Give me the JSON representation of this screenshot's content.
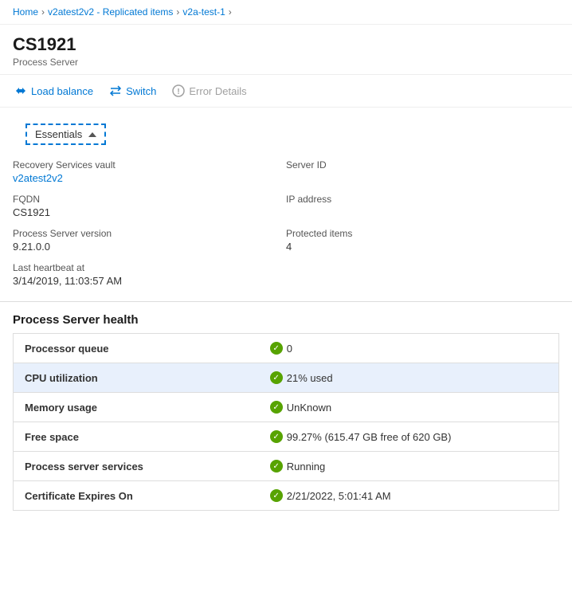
{
  "breadcrumb": {
    "items": [
      {
        "label": "Home",
        "link": true
      },
      {
        "label": "v2atest2v2 - Replicated items",
        "link": true
      },
      {
        "label": "v2a-test-1",
        "link": true
      }
    ]
  },
  "title": {
    "main": "CS1921",
    "subtitle": "Process Server"
  },
  "toolbar": {
    "load_balance": "Load balance",
    "switch": "Switch",
    "error_details": "Error Details"
  },
  "essentials": {
    "tab_label": "Essentials",
    "fields": [
      {
        "label": "Recovery Services vault",
        "value": "v2atest2v2",
        "link": true,
        "col": "left"
      },
      {
        "label": "Server ID",
        "value": "",
        "link": false,
        "col": "right"
      },
      {
        "label": "FQDN",
        "value": "CS1921",
        "link": false,
        "col": "left"
      },
      {
        "label": "IP address",
        "value": "",
        "link": false,
        "col": "right"
      },
      {
        "label": "Process Server version",
        "value": "9.21.0.0",
        "link": false,
        "col": "left"
      },
      {
        "label": "Protected items",
        "value": "4",
        "link": false,
        "col": "right"
      },
      {
        "label": "Last heartbeat at",
        "value": "3/14/2019, 11:03:57 AM",
        "link": false,
        "col": "left"
      }
    ]
  },
  "health": {
    "title": "Process Server health",
    "rows": [
      {
        "label": "Processor queue",
        "value": "0",
        "status": "ok",
        "highlighted": false
      },
      {
        "label": "CPU utilization",
        "value": "21% used",
        "status": "ok",
        "highlighted": true
      },
      {
        "label": "Memory usage",
        "value": "UnKnown",
        "status": "ok",
        "highlighted": false
      },
      {
        "label": "Free space",
        "value": "99.27% (615.47 GB free of 620 GB)",
        "status": "ok",
        "highlighted": false
      },
      {
        "label": "Process server services",
        "value": "Running",
        "status": "ok",
        "highlighted": false
      },
      {
        "label": "Certificate Expires On",
        "value": "2/21/2022, 5:01:41 AM",
        "status": "ok",
        "highlighted": false
      }
    ]
  },
  "icons": {
    "checkmark": "✓",
    "chevron_up": "^",
    "balance_unicode": "⇄",
    "switch_unicode": "↺",
    "error_unicode": "ℹ"
  }
}
